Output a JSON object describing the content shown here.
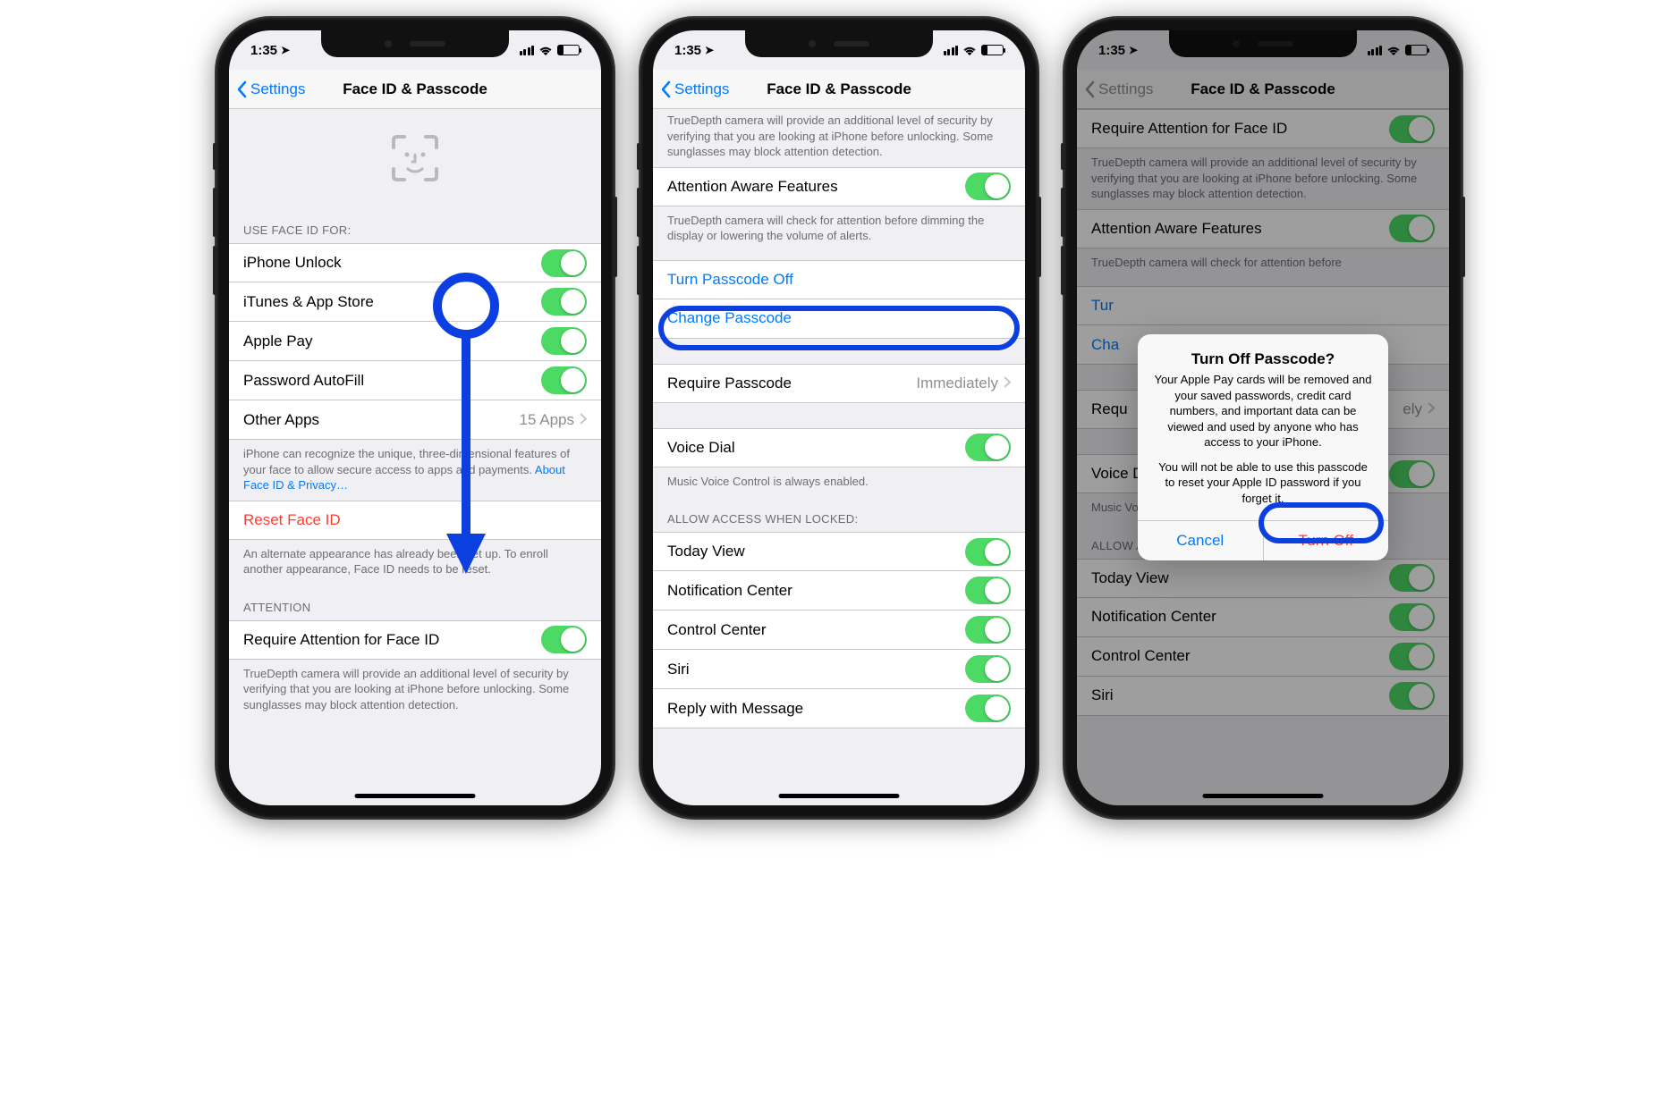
{
  "status": {
    "time": "1:35",
    "loc_glyph": "➤"
  },
  "nav": {
    "back": "Settings",
    "title": "Face ID & Passcode"
  },
  "screen1": {
    "use_header": "USE FACE ID FOR:",
    "rows": {
      "unlock": "iPhone Unlock",
      "itunes": "iTunes & App Store",
      "applepay": "Apple Pay",
      "autofill": "Password AutoFill",
      "otherapps": "Other Apps",
      "otherapps_val": "15 Apps"
    },
    "use_footer": "iPhone can recognize the unique, three-dimensional features of your face to allow secure access to apps and payments. ",
    "use_footer_link": "About Face ID & Privacy…",
    "reset": "Reset Face ID",
    "reset_footer": "An alternate appearance has already been set up. To enroll another appearance, Face ID needs to be reset.",
    "attention_header": "ATTENTION",
    "require_attention": "Require Attention for Face ID",
    "require_attention_footer": "TrueDepth camera will provide an additional level of security by verifying that you are looking at iPhone before unlocking. Some sunglasses may block attention detection."
  },
  "screen2": {
    "truedepth_footer": "TrueDepth camera will provide an additional level of security by verifying that you are looking at iPhone before unlocking. Some sunglasses may block attention detection.",
    "attention_aware": "Attention Aware Features",
    "attention_aware_footer": "TrueDepth camera will check for attention before dimming the display or lowering the volume of alerts.",
    "turn_off": "Turn Passcode Off",
    "change": "Change Passcode",
    "require_passcode": "Require Passcode",
    "require_passcode_val": "Immediately",
    "voice_dial": "Voice Dial",
    "voice_dial_footer": "Music Voice Control is always enabled.",
    "allow_header": "ALLOW ACCESS WHEN LOCKED:",
    "today": "Today View",
    "notif": "Notification Center",
    "control": "Control Center",
    "siri": "Siri",
    "reply": "Reply with Message"
  },
  "screen3": {
    "require_attention": "Require Attention for Face ID",
    "truedepth_footer": "TrueDepth camera will provide an additional level of security by verifying that you are looking at iPhone before unlocking. Some sunglasses may block attention detection.",
    "attention_aware": "Attention Aware Features",
    "attention_aware_footer": "TrueDepth camera will check for attention before",
    "turn_peek": "Tur",
    "change_peek": "Cha",
    "require_passcode": "Requ",
    "require_passcode_val": "ely",
    "voice_dial": "Voice Dial",
    "voice_dial_footer": "Music Voice Control is always enabled.",
    "allow_header": "ALLOW ACCESS WHEN LOCKED:",
    "today": "Today View",
    "notif": "Notification Center",
    "control": "Control Center",
    "siri": "Siri",
    "alert": {
      "title": "Turn Off Passcode?",
      "body1": "Your Apple Pay cards will be removed and your saved passwords, credit card numbers, and important data can be viewed and used by anyone who has access to your iPhone.",
      "body2": "You will not be able to use this passcode to reset your Apple ID password if you forget it.",
      "cancel": "Cancel",
      "turnoff": "Turn Off"
    }
  }
}
